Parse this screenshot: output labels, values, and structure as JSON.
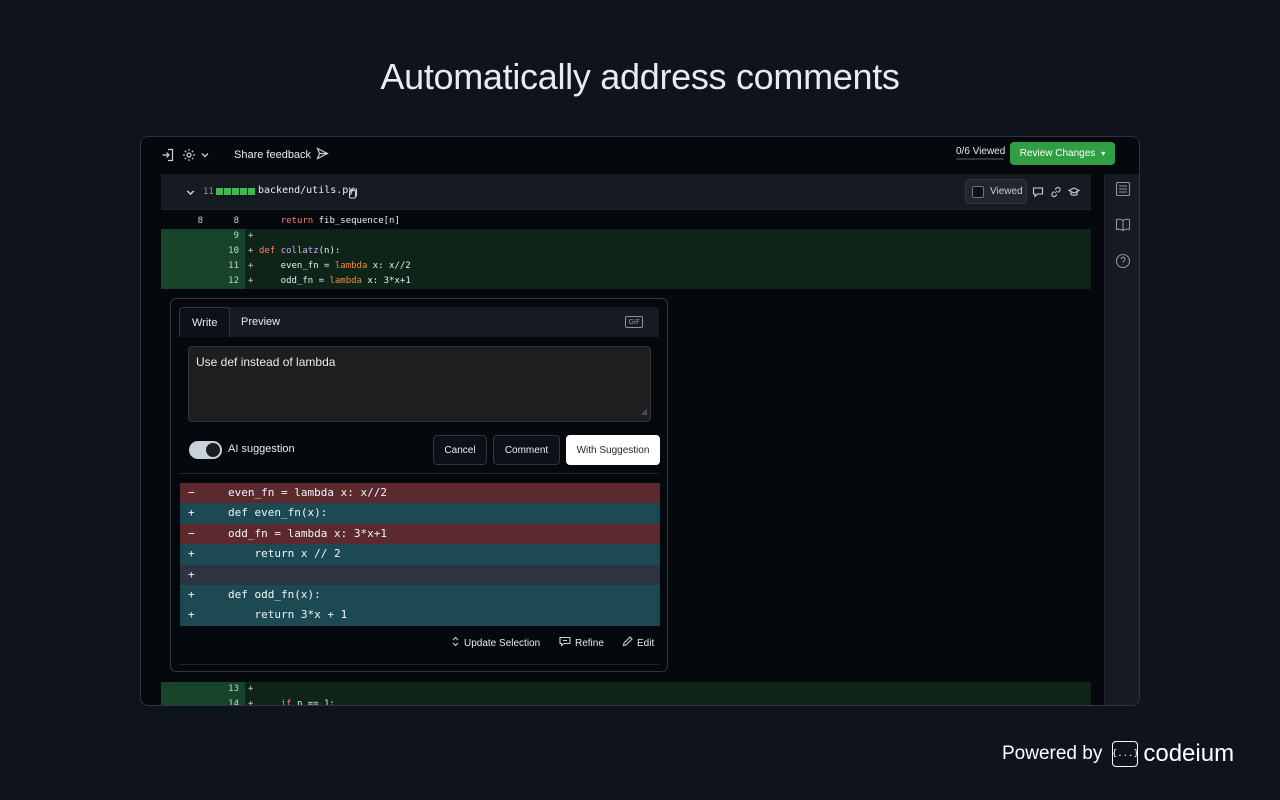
{
  "headline": "Automatically address comments",
  "toolbar": {
    "share_label": "Share feedback",
    "viewed_count": "0/6 Viewed",
    "review_label": "Review Changes",
    "review_caret": "▾"
  },
  "file": {
    "count": "11",
    "path": "backend/utils.py",
    "viewed_label": "Viewed"
  },
  "code_top": [
    {
      "old": "8",
      "new": "8",
      "sign": "",
      "type": "ctx",
      "text": "    return fib_sequence[n]"
    },
    {
      "old": "",
      "new": "9",
      "sign": "+",
      "type": "add",
      "text": ""
    },
    {
      "old": "",
      "new": "10",
      "sign": "+",
      "type": "add",
      "text": "def collatz(n):"
    },
    {
      "old": "",
      "new": "11",
      "sign": "+",
      "type": "add",
      "text": "    even_fn = lambda x: x//2"
    },
    {
      "old": "",
      "new": "12",
      "sign": "+",
      "type": "add",
      "text": "    odd_fn = lambda x: 3*x+1"
    }
  ],
  "code_bottom": [
    {
      "old": "",
      "new": "13",
      "sign": "+",
      "type": "add",
      "text": ""
    },
    {
      "old": "",
      "new": "14",
      "sign": "+",
      "type": "add",
      "text": "    if n == 1:"
    }
  ],
  "comment": {
    "tab_write": "Write",
    "tab_preview": "Preview",
    "gif_label": "GIF",
    "text": "Use def instead of lambda",
    "toggle_label": "AI suggestion",
    "cancel": "Cancel",
    "comment": "Comment",
    "with_suggestion": "With Suggestion"
  },
  "suggestion": [
    {
      "sign": "−",
      "type": "del",
      "text": "even_fn = lambda x: x//2"
    },
    {
      "sign": "+",
      "type": "ins",
      "text": "def even_fn(x):"
    },
    {
      "sign": "−",
      "type": "del",
      "text": "odd_fn = lambda x: 3*x+1"
    },
    {
      "sign": "+",
      "type": "ins",
      "text": "    return x // 2"
    },
    {
      "sign": "+",
      "type": "blank",
      "text": ""
    },
    {
      "sign": "+",
      "type": "ins",
      "text": "def odd_fn(x):"
    },
    {
      "sign": "+",
      "type": "ins",
      "text": "    return 3*x + 1"
    }
  ],
  "suggestion_actions": {
    "update": "Update Selection",
    "refine": "Refine",
    "edit": "Edit"
  },
  "footer": {
    "powered": "Powered by",
    "logo_glyph": "{...}",
    "brand": "codeium"
  }
}
